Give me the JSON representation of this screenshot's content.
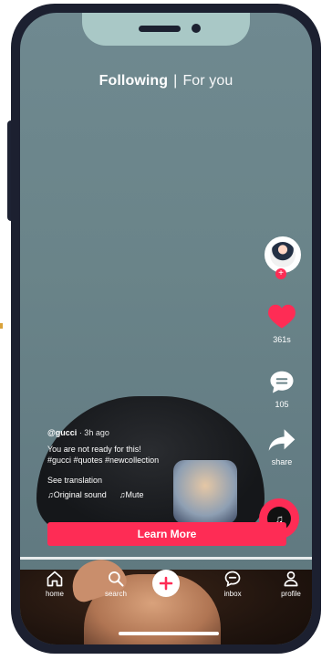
{
  "top_nav": {
    "following": "Following",
    "separator": "|",
    "for_you": "For you"
  },
  "right_rail": {
    "likes_count": "361s",
    "comments_count": "105",
    "share_label": "share"
  },
  "caption": {
    "username": "@gucci",
    "time": "· 3h ago",
    "line1": "You are not ready for this!",
    "line2": "#gucci #quotes #newcollection",
    "see_translation": "See translation",
    "original_sound": "♫Original sound",
    "mute": "♫Mute"
  },
  "cta": {
    "label": "Learn More"
  },
  "tabbar": {
    "home": "home",
    "search": "search",
    "inbox": "inbox",
    "profile": "profile"
  },
  "colors": {
    "accent": "#fe2c55",
    "screen_bg": "#6a8489",
    "device": "#1c2030",
    "notch": "#a9c8c6"
  }
}
